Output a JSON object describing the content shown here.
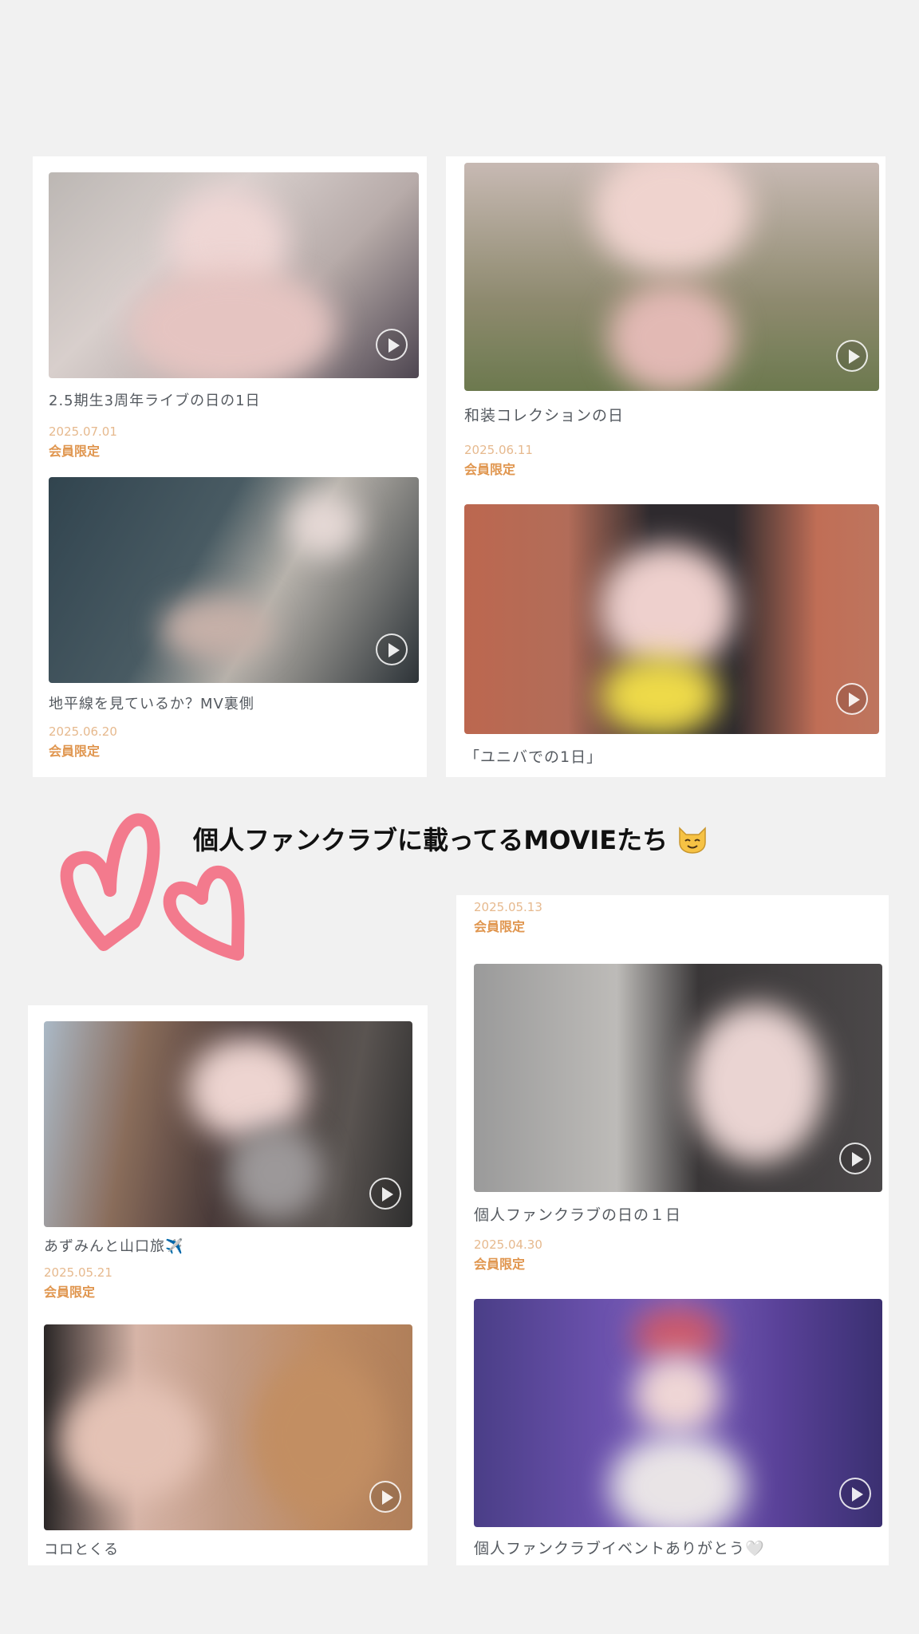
{
  "heading": {
    "text": "個人ファンクラブに載ってるMOVIEたち",
    "emoji_icon": "cat-face-icon"
  },
  "badge_color": "#e0964f",
  "date_color": "#e6b98e",
  "videos": [
    {
      "title": "2.5期生3周年ライブの日の1日",
      "date": "2025.07.01",
      "badge": "会員限定"
    },
    {
      "title": "地平線を見ているか？MV裏側",
      "date": "2025.06.20",
      "badge": "会員限定"
    },
    {
      "title": "和装コレクションの日",
      "date": "2025.06.11",
      "badge": "会員限定"
    },
    {
      "title": "「ユニバでの1日」"
    },
    {
      "title": "あずみんと山口旅✈️",
      "date": "2025.05.21",
      "badge": "会員限定"
    },
    {
      "title": "コロとくる"
    },
    {
      "title": "",
      "date": "2025.05.13",
      "badge": "会員限定"
    },
    {
      "title": "個人ファンクラブの日の１日",
      "date": "2025.04.30",
      "badge": "会員限定"
    },
    {
      "title": "個人ファンクラブイベントありがとう🤍"
    }
  ]
}
